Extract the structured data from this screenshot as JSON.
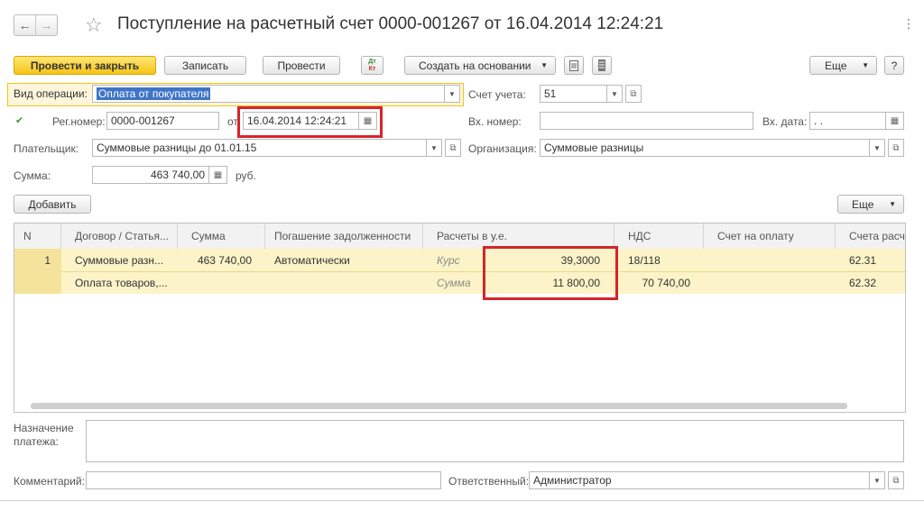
{
  "window": {
    "title": "Поступление на расчетный счет 0000-001267 от 16.04.2014 12:24:21",
    "back_icon": "←",
    "forward_icon": "→",
    "star_icon": "☆",
    "more_icon": "⋮"
  },
  "toolbar": {
    "post_close": "Провести и закрыть",
    "save": "Записать",
    "post": "Провести",
    "dtkt_top": "Дт",
    "dtkt_bottom": "Кт",
    "create_based": "Создать на основании",
    "more": "Еще",
    "help": "?"
  },
  "form": {
    "op_type_label": "Вид операции:",
    "op_type_value": "Оплата от покупателя",
    "account_label": "Счет учета:",
    "account_value": "51",
    "reg_label": "Рег.номер:",
    "reg_value": "0000-001267",
    "from_label": "от",
    "date_value": "16.04.2014 12:24:21",
    "in_num_label": "Вх. номер:",
    "in_num_value": "",
    "in_date_label": "Вх. дата:",
    "in_date_value": " .  .",
    "payer_label": "Плательщик:",
    "payer_value": "Суммовые разницы до 01.01.15",
    "org_label": "Организация:",
    "org_value": "Суммовые разницы",
    "sum_label": "Сумма:",
    "sum_value": "463 740,00",
    "currency": "руб."
  },
  "table_toolbar": {
    "add": "Добавить",
    "more": "Еще"
  },
  "table": {
    "headers": [
      "N",
      "Договор / Статья...",
      "Сумма",
      "Погашение задолженности",
      "Расчеты в у.е.",
      "НДС",
      "Счет на оплату",
      "Счета расче"
    ],
    "row1": {
      "n": "1",
      "contract": "Суммовые разн...",
      "sum": "463 740,00",
      "repay": "Автоматически",
      "rate_label": "Курс",
      "rate_value": "39,3000",
      "vat_rate": "18/118",
      "acc": "62.31"
    },
    "row2": {
      "contract": "Оплата товаров,...",
      "sum_label": "Сумма",
      "sum_value": "11 800,00",
      "vat_sum": "70 740,00",
      "acc": "62.32"
    }
  },
  "footer": {
    "purpose_label_1": "Назначение",
    "purpose_label_2": "платежа:",
    "purpose_value": "",
    "comment_label": "Комментарий:",
    "comment_value": "",
    "responsible_label": "Ответственный:",
    "responsible_value": "Администратор"
  },
  "colors": {
    "accent_yellow": "#f5c417",
    "selection_row": "#fcf4c8",
    "highlight_red": "#d8232a",
    "header_bg": "#f2f2f2"
  }
}
